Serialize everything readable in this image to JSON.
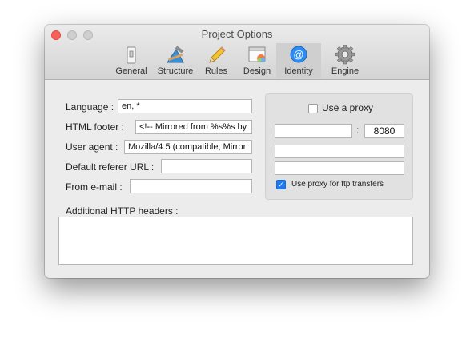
{
  "window": {
    "title": "Project Options"
  },
  "toolbar": {
    "tabs": [
      {
        "label": "General",
        "icon": "general-switch-icon"
      },
      {
        "label": "Structure",
        "icon": "structure-tools-icon"
      },
      {
        "label": "Rules",
        "icon": "pencil-icon"
      },
      {
        "label": "Design",
        "icon": "design-window-icon"
      },
      {
        "label": "Identity",
        "icon": "at-sign-icon",
        "active": true
      },
      {
        "label": "Engine",
        "icon": "gear-icon"
      }
    ]
  },
  "form": {
    "language": {
      "label": "Language :",
      "value": "en, *"
    },
    "html_footer": {
      "label": "HTML footer :",
      "value": "<!-- Mirrored from %s%s by"
    },
    "user_agent": {
      "label": "User agent :",
      "value": "Mozilla/4.5 (compatible; Mirror"
    },
    "default_referer": {
      "label": "Default referer URL :",
      "value": ""
    },
    "from_email": {
      "label": "From e-mail :",
      "value": ""
    },
    "additional_headers": {
      "label": "Additional HTTP headers :",
      "value": ""
    }
  },
  "proxy": {
    "use_proxy_label": "Use a proxy",
    "use_proxy_checked": false,
    "host": "",
    "separator": ":",
    "port": "8080",
    "username": "",
    "password": "",
    "ftp_label": "Use proxy for ftp transfers",
    "ftp_checked": true,
    "checkmark": "✓"
  },
  "colors": {
    "accent": "#1f7bf2",
    "close": "#fc605b"
  }
}
